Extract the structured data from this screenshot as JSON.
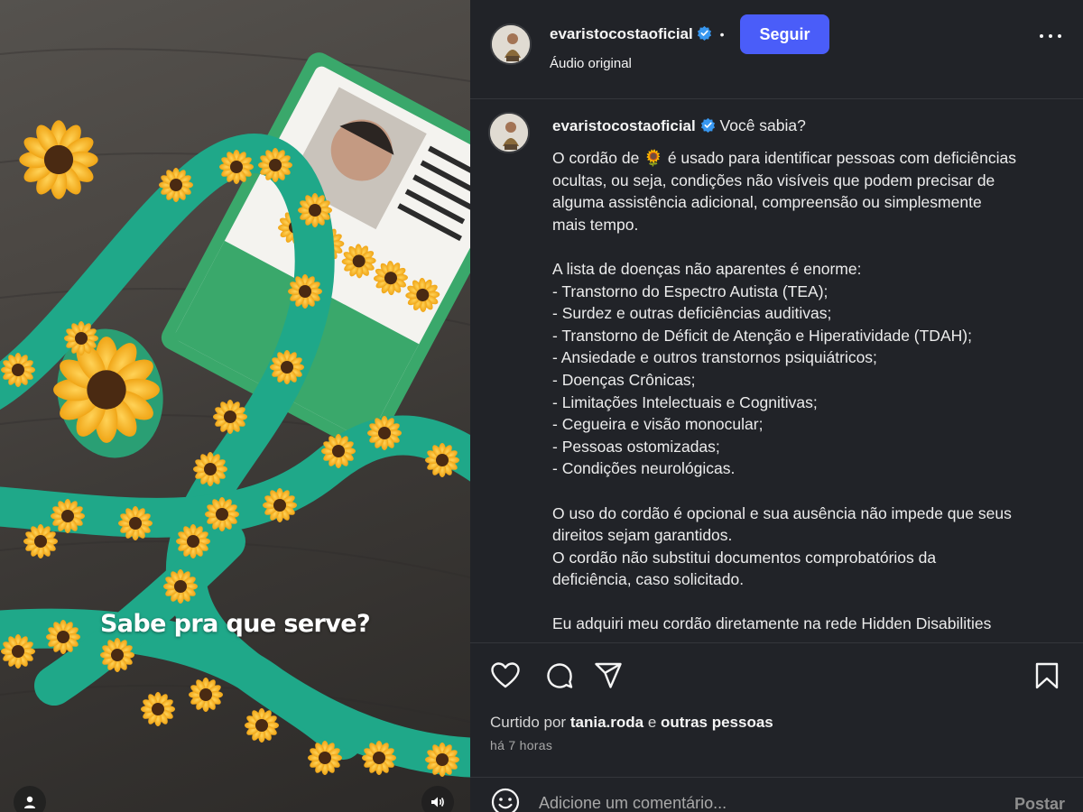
{
  "media": {
    "caption": "Sabe pra que serve?",
    "icons": {
      "user": "user-icon",
      "volume": "volume-icon"
    }
  },
  "header": {
    "username": "evaristocostaoficial",
    "separator": "•",
    "follow_label": "Seguir",
    "audio_label": "Áudio original",
    "icons": {
      "verified": "verified-badge-icon",
      "more": "more-options-icon"
    }
  },
  "post": {
    "username": "evaristocostaoficial",
    "first_line": "Você sabia?",
    "lines": [
      "O cordão de 🌻 é usado para identificar pessoas com deficiências",
      "ocultas, ou seja, condições não visíveis que podem precisar de",
      "alguma assistência adicional, compreensão ou simplesmente",
      "mais tempo.",
      "",
      "A lista de doenças não aparentes é enorme:",
      "- Transtorno do Espectro Autista (TEA);",
      "- Surdez e outras deficiências auditivas;",
      "- Transtorno de Déficit de Atenção e Hiperatividade (TDAH);",
      "- Ansiedade e outros transtornos psiquiátricos;",
      "- Doenças Crônicas;",
      "- Limitações Intelectuais e Cognitivas;",
      "- Cegueira e visão monocular;",
      "- Pessoas ostomizadas;",
      "- Condições neurológicas.",
      "",
      "O uso do cordão é opcional e sua ausência não impede que seus",
      "direitos sejam garantidos.",
      "O cordão não substitui documentos comprobatórios da",
      "deficiência, caso solicitado.",
      "",
      "Eu adquiri meu cordão diretamente na rede Hidden Disabilities"
    ]
  },
  "actions": {
    "icons": [
      "heart-icon",
      "comment-icon",
      "share-icon",
      "bookmark-icon"
    ],
    "liked_prefix": "Curtido por",
    "liked_user": "tania.roda",
    "liked_joiner": "e",
    "liked_others": "outras pessoas",
    "time_ago": "há 7 horas"
  },
  "comment_box": {
    "placeholder": "Adicione um comentário...",
    "post_label": "Postar",
    "emoji_icon": "emoji-icon"
  },
  "colors": {
    "panel_bg": "#212328",
    "follow_button": "#4a5df9",
    "verified_badge": "#3897f0",
    "ribbon_green": "#1fa889",
    "sunflower_petal": "#f2b01e"
  }
}
